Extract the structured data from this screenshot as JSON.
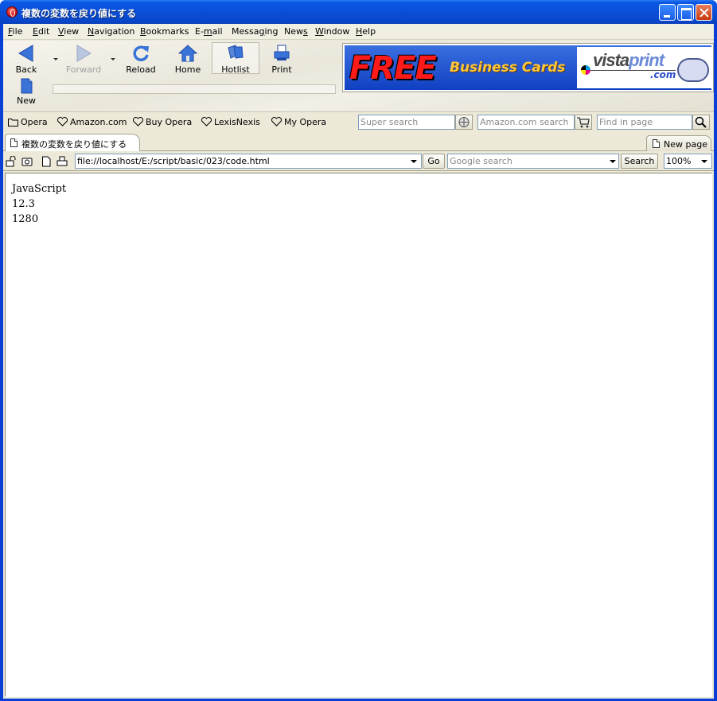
{
  "window": {
    "title": "複数の変数を戻り値にする"
  },
  "menu": [
    {
      "label": "File",
      "accel": "F",
      "rest": "ile"
    },
    {
      "label": "Edit",
      "accel": "E",
      "rest": "dit"
    },
    {
      "label": "View",
      "accel": "V",
      "rest": "iew"
    },
    {
      "label": "Navigation",
      "accel": "N",
      "rest": "avigation"
    },
    {
      "label": "Bookmarks",
      "accel": "B",
      "rest": "ookmarks"
    },
    {
      "label": "E-mail",
      "pre": "E-",
      "accel": "m",
      "rest": "ail"
    },
    {
      "label": "Messaging",
      "pre": "Messa",
      "accel": "g",
      "rest": "ing"
    },
    {
      "label": "News",
      "pre": "New",
      "accel": "s",
      "rest": ""
    },
    {
      "label": "Window",
      "accel": "W",
      "rest": "indow"
    },
    {
      "label": "Help",
      "accel": "H",
      "rest": "elp"
    }
  ],
  "toolbar": {
    "back": "Back",
    "forward": "Forward",
    "reload": "Reload",
    "home": "Home",
    "hotlist": "Hotlist",
    "print": "Print",
    "new": "New"
  },
  "ad": {
    "free": "FREE",
    "business_cards": "Business Cards",
    "brand_a": "vista",
    "brand_b": "print",
    "brand_com": ".com"
  },
  "personal_bar": {
    "items": [
      "Opera",
      "Amazon.com",
      "Buy Opera",
      "LexisNexis",
      "My Opera"
    ],
    "super_search_placeholder": "Super search",
    "amazon_search_placeholder": "Amazon.com search",
    "find_placeholder": "Find in page"
  },
  "tabs": {
    "active_title": "複数の変数を戻り値にする",
    "new_page": "New page"
  },
  "address": {
    "url": "file://localhost/E:/script/basic/023/code.html",
    "go": "Go",
    "google_placeholder": "Google search",
    "search": "Search",
    "zoom": "100%"
  },
  "content": {
    "lines": [
      "JavaScript",
      "12.3",
      "1280"
    ]
  }
}
